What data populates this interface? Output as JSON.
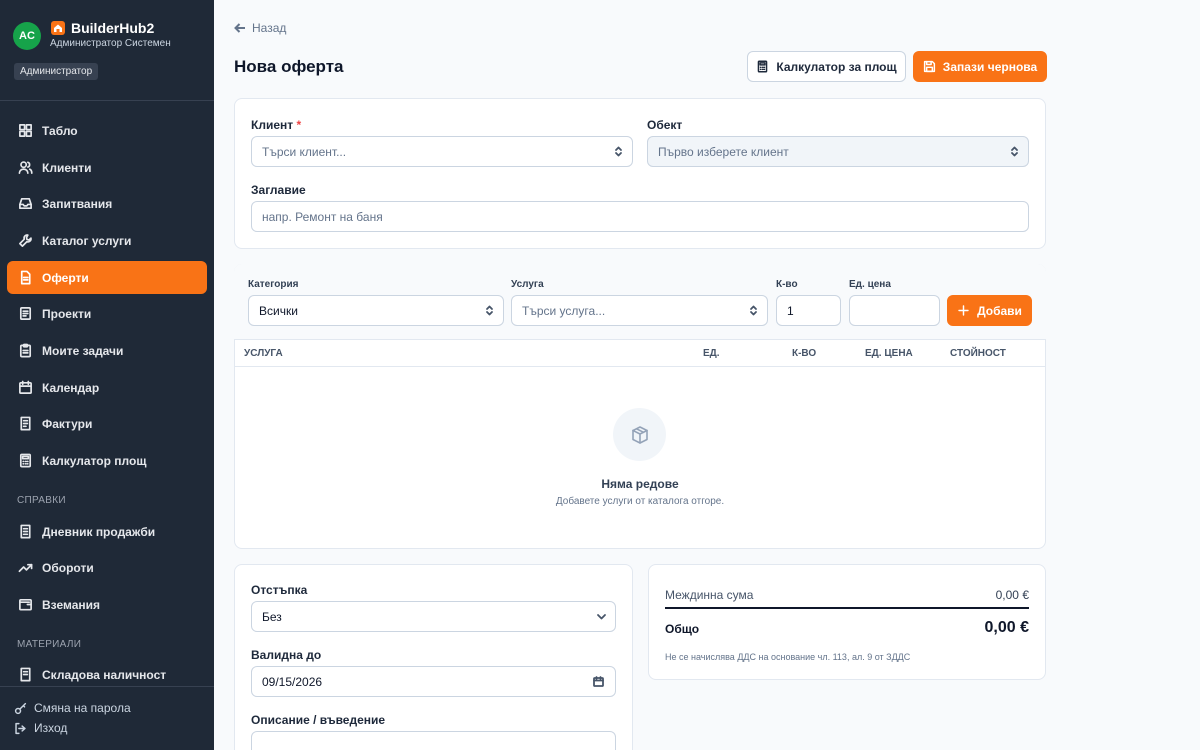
{
  "sidebar": {
    "avatar_initials": "AC",
    "brand_name": "BuilderHub2",
    "user_name": "Администратор Системен",
    "role_badge": "Администратор",
    "items": [
      {
        "label": "Табло",
        "icon": "dashboard-icon"
      },
      {
        "label": "Клиенти",
        "icon": "users-icon"
      },
      {
        "label": "Запитвания",
        "icon": "inbox-icon"
      },
      {
        "label": "Каталог услуги",
        "icon": "wrench-icon"
      },
      {
        "label": "Оферти",
        "icon": "file-icon",
        "active": true
      },
      {
        "label": "Проекти",
        "icon": "folder-icon"
      },
      {
        "label": "Моите задачи",
        "icon": "clipboard-icon"
      },
      {
        "label": "Календар",
        "icon": "calendar-icon"
      },
      {
        "label": "Фактури",
        "icon": "invoice-icon"
      },
      {
        "label": "Калкулатор площ",
        "icon": "calculator-icon"
      }
    ],
    "section_reports": "СПРАВКИ",
    "reports": [
      {
        "label": "Дневник продажби",
        "icon": "journal-icon"
      },
      {
        "label": "Обороти",
        "icon": "trending-icon"
      },
      {
        "label": "Вземания",
        "icon": "wallet-icon"
      }
    ],
    "section_materials": "МАТЕРИАЛИ",
    "materials": [
      {
        "label": "Складова наличност",
        "icon": "warehouse-icon"
      }
    ],
    "footer": {
      "change_password": "Смяна на парола",
      "logout": "Изход"
    }
  },
  "header": {
    "back_label": "Назад",
    "title": "Нова оферта",
    "calculator_button": "Калкулатор за площ",
    "save_draft_button": "Запази чернова"
  },
  "form": {
    "client_label": "Клиент",
    "client_required": "*",
    "client_placeholder": "Търси клиент...",
    "object_label": "Обект",
    "object_placeholder": "Първо изберете клиент",
    "title_label": "Заглавие",
    "title_placeholder": "напр. Ремонт на баня"
  },
  "line_add": {
    "category_label": "Категория",
    "category_value": "Всички",
    "service_label": "Услуга",
    "service_placeholder": "Търси услуга...",
    "qty_label": "К-во",
    "qty_value": "1",
    "unit_price_label": "Ед. цена",
    "unit_price_value": "",
    "add_button": "Добави"
  },
  "table": {
    "columns": [
      "УСЛУГА",
      "ЕД.",
      "К-ВО",
      "ЕД. ЦЕНА",
      "СТОЙНОСТ"
    ],
    "empty_title": "Няма редове",
    "empty_subtitle": "Добавете услуги от каталога отгоре."
  },
  "options": {
    "discount_label": "Отстъпка",
    "discount_value": "Без",
    "valid_until_label": "Валидна до",
    "valid_until_value": "09/15/2026",
    "description_label": "Описание / въведение"
  },
  "summary": {
    "subtotal_label": "Междинна сума",
    "subtotal_value": "0,00 €",
    "total_label": "Общо",
    "total_value": "0,00 €",
    "vat_note": "Не се начислява ДДС на основание чл. 113, ал. 9 от ЗДДС"
  },
  "colors": {
    "accent": "#f97316",
    "sidebar_bg": "#1f2937",
    "avatar_bg": "#16a34a"
  }
}
